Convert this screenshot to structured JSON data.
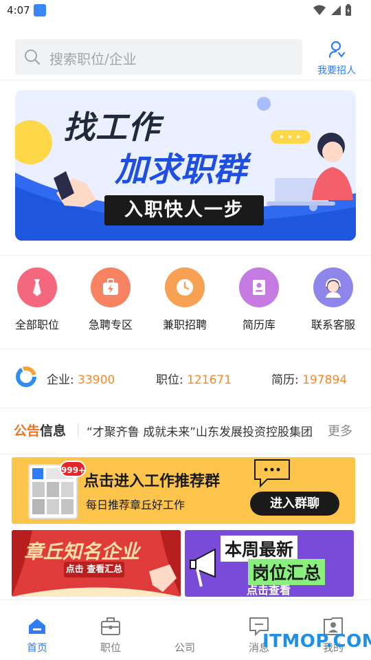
{
  "status_bar": {
    "time": "4:07"
  },
  "header": {
    "search_placeholder": "搜索职位/企业",
    "recruit_label": "我要招人"
  },
  "banner": {
    "line1": "找工作",
    "line2": "加求职群",
    "line3": "入职快人一步"
  },
  "categories": [
    {
      "label": "全部职位",
      "icon": "tie-icon",
      "color": "#f5677d"
    },
    {
      "label": "急聘专区",
      "icon": "briefcase-bolt-icon",
      "color": "#f78363"
    },
    {
      "label": "兼职招聘",
      "icon": "clock-icon",
      "color": "#f7a153"
    },
    {
      "label": "简历库",
      "icon": "resume-book-icon",
      "color": "#c67be3"
    },
    {
      "label": "联系客服",
      "icon": "customer-service-icon",
      "color": "#8f86ec"
    }
  ],
  "stats": {
    "company_label": "企业:",
    "company_value": "33900",
    "job_label": "职位:",
    "job_value": "121671",
    "resume_label": "简历:",
    "resume_value": "197894"
  },
  "notice": {
    "brand_part1": "公告",
    "brand_part2": "信息",
    "text": "“才聚齐鲁 成就未来”山东发展投资控股集团",
    "more": "更多"
  },
  "promo": {
    "badge": "999+",
    "title": "点击进入工作推荐群",
    "subtitle": "每日推荐章丘好工作",
    "button": "进入群聊"
  },
  "tiles": {
    "left_title": "章丘知名企业",
    "left_sub": "点击 查看汇总",
    "right_title1": "本周最新",
    "right_title2": "岗位汇总",
    "right_sub": "点击查看"
  },
  "bottom_nav": [
    {
      "label": "首页",
      "icon": "home-icon",
      "active": true
    },
    {
      "label": "职位",
      "icon": "briefcase-icon",
      "active": false
    },
    {
      "label": "公司",
      "icon": "company-icon",
      "active": false
    },
    {
      "label": "消息",
      "icon": "message-icon",
      "active": false
    },
    {
      "label": "我的",
      "icon": "profile-icon",
      "active": false
    }
  ],
  "watermark": "ITMOP.COM",
  "colors": {
    "accent": "#2f7cf6",
    "stat_value": "#f08a2a"
  }
}
